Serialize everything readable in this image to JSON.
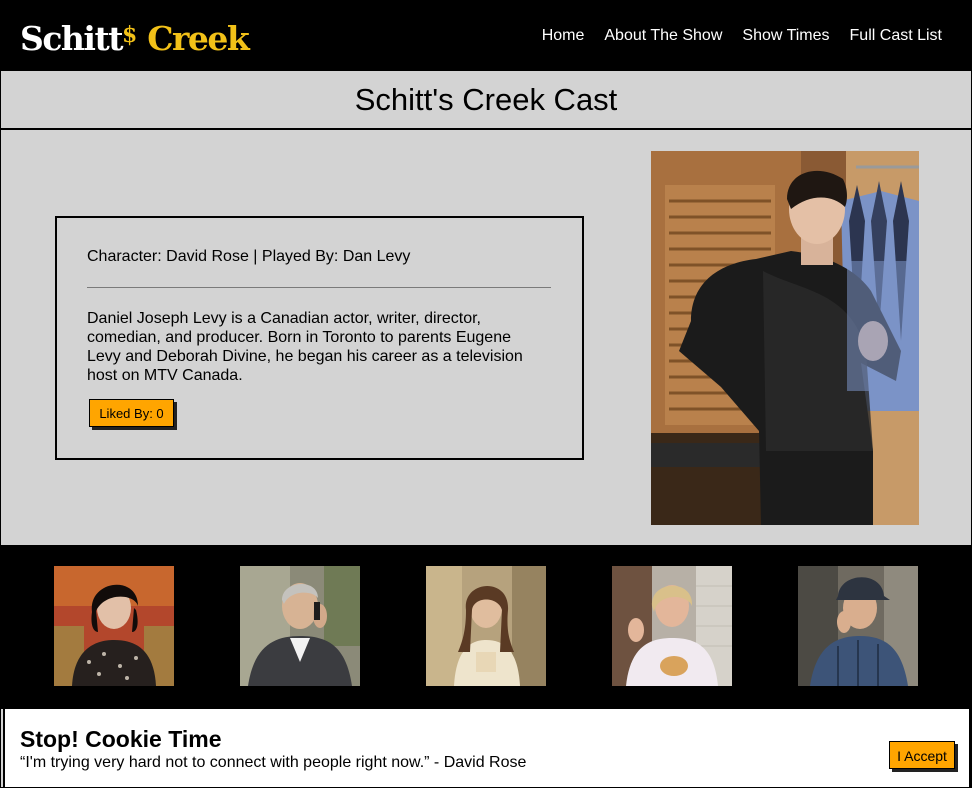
{
  "header": {
    "logo": {
      "part1": "Schitt",
      "dollar": "$",
      "part2": "Creek"
    },
    "nav": [
      "Home",
      "About The Show",
      "Show Times",
      "Full Cast List"
    ]
  },
  "page_title": "Schitt's Creek Cast",
  "featured": {
    "character_line": "Character: David Rose | Played By: Dan Levy",
    "bio": "Daniel Joseph Levy is a Canadian actor, writer, director, comedian, and producer. Born in Toronto to parents Eugene Levy and Deborah Divine, he began his career as a television host on MTV Canada.",
    "like_button": "Liked By: 0",
    "photo_icon": "portrait-photo"
  },
  "thumbnails": [
    {
      "icon": "cast-photo-moira"
    },
    {
      "icon": "cast-photo-johnny"
    },
    {
      "icon": "cast-photo-alexis"
    },
    {
      "icon": "cast-photo-jocelyn"
    },
    {
      "icon": "cast-photo-roland"
    }
  ],
  "cookie_banner": {
    "title": "Stop! Cookie Time",
    "quote": "“I'm trying very hard not to connect with people right now.” - David Rose",
    "accept_button": "I Accept"
  },
  "colors": {
    "accent_button": "#ffa500",
    "logo_gold": "#f2c118",
    "background": "#d3d3d3",
    "header": "#000000"
  }
}
